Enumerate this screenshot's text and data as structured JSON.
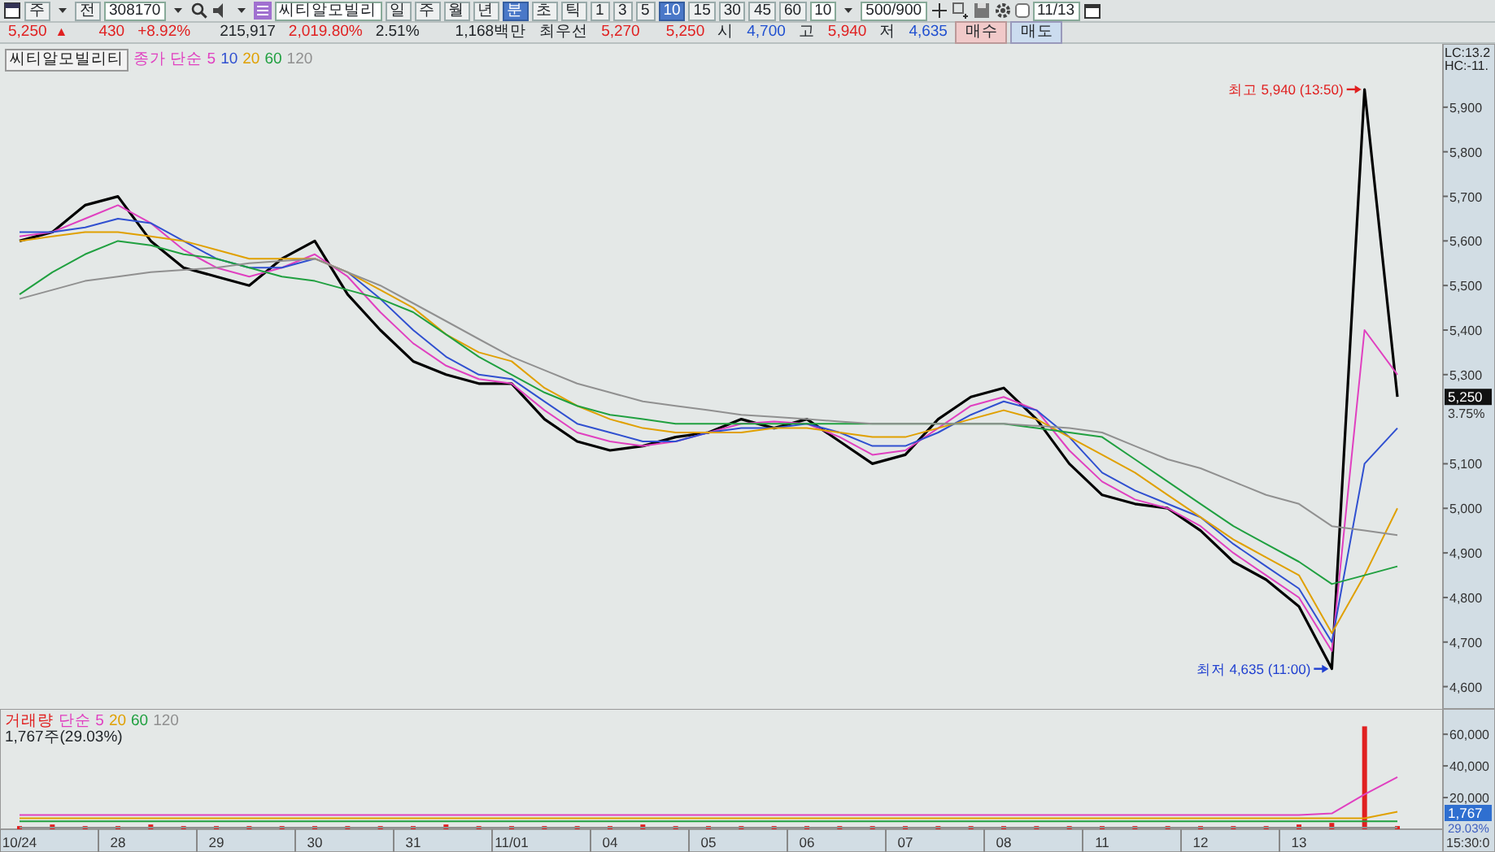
{
  "toolbar": {
    "market": "주",
    "scope": "전",
    "code": "308170",
    "name": "씨티알모빌리",
    "periods": [
      {
        "label": "일",
        "selected": false
      },
      {
        "label": "주",
        "selected": false
      },
      {
        "label": "월",
        "selected": false
      },
      {
        "label": "년",
        "selected": false
      },
      {
        "label": "분",
        "selected": true
      },
      {
        "label": "초",
        "selected": false
      },
      {
        "label": "틱",
        "selected": false
      }
    ],
    "intervals": [
      {
        "label": "1",
        "selected": false
      },
      {
        "label": "3",
        "selected": false
      },
      {
        "label": "5",
        "selected": false
      },
      {
        "label": "10",
        "selected": true
      },
      {
        "label": "15",
        "selected": false
      },
      {
        "label": "30",
        "selected": false
      },
      {
        "label": "45",
        "selected": false
      },
      {
        "label": "60",
        "selected": false
      }
    ],
    "count": "10",
    "range": "500/900",
    "date_checked": false,
    "date": "11/13"
  },
  "quote": {
    "price": "5,250",
    "direction": "▲",
    "change": "430",
    "change_pct": "+8.92%",
    "volume": "215,917",
    "volume_pct": "2,019.80%",
    "turnover_pct": "2.51%",
    "amount": "1,168백만",
    "best_label": "최우선",
    "best_ask": "5,270",
    "best_bid": "5,250",
    "open_label": "시",
    "open": "4,700",
    "high_label": "고",
    "high": "5,940",
    "low_label": "저",
    "low": "4,635",
    "buy": "매수",
    "sell": "매도"
  },
  "price_pane": {
    "axis_notes": [
      "LC:13.2",
      "HC:-11."
    ],
    "last_marker": {
      "price": "5,250",
      "pct": "3.75%"
    },
    "chart_data": {
      "type": "line",
      "categories": [
        null,
        null,
        null,
        null,
        null,
        null,
        null,
        null,
        null,
        null,
        null,
        null,
        null,
        null,
        null,
        null,
        null,
        null,
        null,
        null,
        null,
        null,
        null,
        null,
        null,
        null,
        null,
        null,
        null,
        null,
        null,
        null,
        null,
        null,
        null,
        null,
        null,
        null,
        null,
        null,
        null,
        null,
        null
      ],
      "ylim": [
        4550,
        6042
      ],
      "yticks": [
        {
          "value": 5900,
          "label": "5,900"
        },
        {
          "value": 5800,
          "label": "5,800"
        },
        {
          "value": 5700,
          "label": "5,700"
        },
        {
          "value": 5600,
          "label": "5,600"
        },
        {
          "value": 5500,
          "label": "5,500"
        },
        {
          "value": 5400,
          "label": "5,400"
        },
        {
          "value": 5300,
          "label": "5,300"
        },
        {
          "value": 5100,
          "label": "5,100"
        },
        {
          "value": 5000,
          "label": "5,000"
        },
        {
          "value": 4900,
          "label": "4,900"
        },
        {
          "value": 4800,
          "label": "4,800"
        },
        {
          "value": 4700,
          "label": "4,700"
        },
        {
          "value": 4600,
          "label": "4,600"
        }
      ],
      "series": [
        {
          "name": "씨티알모빌리티",
          "color": "#000000",
          "values": [
            5600,
            5620,
            5680,
            5700,
            5600,
            5540,
            5520,
            5500,
            5560,
            5600,
            5480,
            5400,
            5330,
            5300,
            5280,
            5280,
            5200,
            5150,
            5130,
            5140,
            5160,
            5170,
            5200,
            5180,
            5200,
            5150,
            5100,
            5120,
            5200,
            5250,
            5270,
            5200,
            5100,
            5030,
            5010,
            5000,
            4950,
            4880,
            4840,
            4780,
            4640,
            5940,
            5250
          ]
        },
        {
          "name": "종가 단순 5",
          "color": "#e040c0",
          "values": [
            5610,
            5620,
            5650,
            5680,
            5640,
            5580,
            5540,
            5520,
            5540,
            5570,
            5520,
            5440,
            5370,
            5320,
            5290,
            5280,
            5220,
            5170,
            5150,
            5140,
            5150,
            5170,
            5190,
            5195,
            5190,
            5160,
            5120,
            5130,
            5180,
            5230,
            5250,
            5220,
            5130,
            5060,
            5020,
            5000,
            4960,
            4900,
            4850,
            4800,
            4680,
            5400,
            5300
          ]
        },
        {
          "name": "10",
          "color": "#3050d0",
          "values": [
            5620,
            5620,
            5630,
            5650,
            5640,
            5600,
            5560,
            5540,
            5540,
            5560,
            5530,
            5470,
            5400,
            5340,
            5300,
            5290,
            5240,
            5190,
            5170,
            5150,
            5150,
            5170,
            5180,
            5180,
            5190,
            5170,
            5140,
            5140,
            5170,
            5210,
            5240,
            5220,
            5160,
            5080,
            5040,
            5010,
            4980,
            4920,
            4870,
            4820,
            4700,
            5100,
            5180
          ]
        },
        {
          "name": "20",
          "color": "#e0a000",
          "values": [
            5600,
            5610,
            5620,
            5620,
            5610,
            5600,
            5580,
            5560,
            5560,
            5560,
            5530,
            5490,
            5450,
            5390,
            5350,
            5330,
            5270,
            5230,
            5200,
            5180,
            5170,
            5170,
            5170,
            5180,
            5180,
            5170,
            5160,
            5160,
            5180,
            5200,
            5220,
            5200,
            5160,
            5120,
            5080,
            5030,
            4980,
            4930,
            4890,
            4850,
            4720,
            4850,
            5000
          ]
        },
        {
          "name": "60",
          "color": "#20a040",
          "values": [
            5480,
            5530,
            5570,
            5600,
            5590,
            5570,
            5560,
            5540,
            5520,
            5510,
            5490,
            5470,
            5440,
            5390,
            5340,
            5300,
            5260,
            5230,
            5210,
            5200,
            5190,
            5190,
            5190,
            5190,
            5190,
            5190,
            5190,
            5190,
            5190,
            5190,
            5190,
            5180,
            5170,
            5160,
            5110,
            5060,
            5010,
            4960,
            4920,
            4880,
            4830,
            4850,
            4870
          ]
        },
        {
          "name": "120",
          "color": "#909090",
          "values": [
            5470,
            5490,
            5510,
            5520,
            5530,
            5535,
            5540,
            5550,
            5555,
            5560,
            5530,
            5500,
            5460,
            5420,
            5380,
            5340,
            5310,
            5280,
            5260,
            5240,
            5230,
            5220,
            5210,
            5205,
            5200,
            5195,
            5190,
            5190,
            5190,
            5190,
            5190,
            5185,
            5180,
            5170,
            5140,
            5110,
            5090,
            5060,
            5030,
            5010,
            4960,
            4950,
            4940
          ]
        }
      ],
      "annotations": [
        "최고 5,940 (13:50)",
        "최저 4,635 (11:00)"
      ]
    }
  },
  "volume_pane": {
    "status": "1,767주(29.03%)",
    "last_marker": {
      "value": "1,767",
      "pct": "29.03%"
    },
    "time_label": "15:30:0",
    "chart_data": {
      "type": "bar",
      "categories": [
        "10/24",
        null,
        null,
        "28",
        null,
        null,
        "29",
        null,
        null,
        "30",
        null,
        null,
        "31",
        null,
        null,
        "11/01",
        null,
        null,
        "04",
        null,
        null,
        "05",
        null,
        null,
        "06",
        null,
        null,
        "07",
        null,
        null,
        "08",
        null,
        null,
        "11",
        null,
        null,
        "12",
        null,
        null,
        "13",
        null,
        null,
        null
      ],
      "ylim": [
        0,
        76000
      ],
      "yticks": [
        {
          "value": 60000,
          "label": "60,000"
        },
        {
          "value": 40000,
          "label": "40,000"
        },
        {
          "value": 20000,
          "label": "20,000"
        }
      ],
      "series": [
        {
          "name": "거래량",
          "color": "#e02020",
          "values": [
            2000,
            3000,
            2000,
            2000,
            3000,
            2000,
            2000,
            2000,
            2000,
            2000,
            2000,
            2000,
            2000,
            3000,
            2000,
            2000,
            2000,
            2000,
            2000,
            3000,
            2000,
            2000,
            2000,
            2000,
            2000,
            2000,
            2000,
            2000,
            2000,
            2000,
            2000,
            2000,
            2000,
            2000,
            2000,
            2000,
            2000,
            2000,
            2000,
            3000,
            4000,
            65000,
            2000
          ]
        },
        {
          "name": "단순 5",
          "type": "line",
          "color": "#e040c0",
          "values": [
            9000,
            9000,
            9000,
            9000,
            9000,
            9000,
            9000,
            9000,
            9000,
            9000,
            9000,
            9000,
            9000,
            9000,
            9000,
            9000,
            9000,
            9000,
            9000,
            9000,
            9000,
            9000,
            9000,
            9000,
            9000,
            9000,
            9000,
            9000,
            9000,
            9000,
            9000,
            9000,
            9000,
            9000,
            9000,
            9000,
            9000,
            9000,
            9000,
            9000,
            10000,
            22000,
            33000
          ]
        },
        {
          "name": "20",
          "type": "line",
          "color": "#e0a000",
          "values": [
            7000,
            7000,
            7000,
            7000,
            7000,
            7000,
            7000,
            7000,
            7000,
            7000,
            7000,
            7000,
            7000,
            7000,
            7000,
            7000,
            7000,
            7000,
            7000,
            7000,
            7000,
            7000,
            7000,
            7000,
            7000,
            7000,
            7000,
            7000,
            7000,
            7000,
            7000,
            7000,
            7000,
            7000,
            7000,
            7000,
            7000,
            7000,
            7000,
            7000,
            7000,
            7000,
            11000
          ]
        },
        {
          "name": "60",
          "type": "line",
          "color": "#20a040",
          "values": [
            5000,
            5000,
            5000,
            5000,
            5000,
            5000,
            5000,
            5000,
            5000,
            5000,
            5000,
            5000,
            5000,
            5000,
            5000,
            5000,
            5000,
            5000,
            5000,
            5000,
            5000,
            5000,
            5000,
            5000,
            5000,
            5000,
            5000,
            5000,
            5000,
            5000,
            5000,
            5000,
            5000,
            5000,
            5000,
            5000,
            5000,
            5000,
            5000,
            5000,
            5000,
            5000,
            5000
          ]
        },
        {
          "name": "120",
          "type": "line",
          "color": "#909090",
          "values": [
            1000,
            1000,
            1000,
            1000,
            1000,
            1000,
            1000,
            1000,
            1000,
            1000,
            1000,
            1000,
            1000,
            1000,
            1000,
            1000,
            1000,
            1000,
            1000,
            1000,
            1000,
            1000,
            1000,
            1000,
            1000,
            1000,
            1000,
            1000,
            1000,
            1000,
            1000,
            1000,
            1000,
            1000,
            1000,
            1000,
            1000,
            1000,
            1000,
            1000,
            1000,
            1000,
            1000
          ]
        }
      ]
    }
  }
}
